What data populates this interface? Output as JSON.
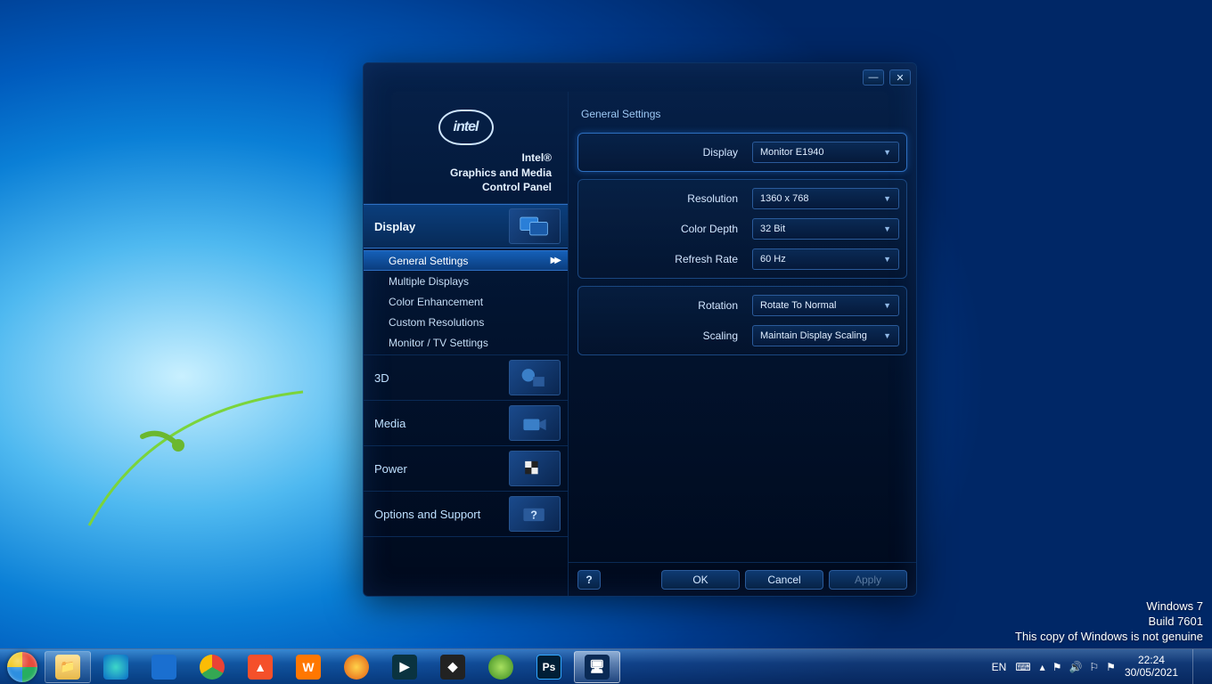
{
  "window": {
    "logo_text": "intel",
    "title_line1": "Intel®",
    "title_line2": "Graphics and Media",
    "title_line3": "Control Panel",
    "minimize_glyph": "—",
    "close_glyph": "✕"
  },
  "nav": {
    "display": "Display",
    "sub_general": "General Settings",
    "sub_multiple": "Multiple Displays",
    "sub_color": "Color Enhancement",
    "sub_custom": "Custom Resolutions",
    "sub_monitor": "Monitor / TV Settings",
    "three_d": "3D",
    "media": "Media",
    "power": "Power",
    "options": "Options and Support",
    "arrow": "▶▶"
  },
  "content": {
    "section_title": "General Settings",
    "rows": {
      "display_label": "Display",
      "display_value": "Monitor E1940",
      "resolution_label": "Resolution",
      "resolution_value": "1360 x 768",
      "depth_label": "Color Depth",
      "depth_value": "32 Bit",
      "refresh_label": "Refresh Rate",
      "refresh_value": "60 Hz",
      "rotation_label": "Rotation",
      "rotation_value": "Rotate To Normal",
      "scaling_label": "Scaling",
      "scaling_value": "Maintain Display Scaling"
    },
    "caret": "▼"
  },
  "buttons": {
    "help": "?",
    "ok": "OK",
    "cancel": "Cancel",
    "apply": "Apply"
  },
  "watermark": {
    "line1": "Windows 7",
    "line2": "Build 7601",
    "line3": "This copy of Windows is not genuine"
  },
  "tray": {
    "lang": "EN",
    "keyboard": "⌨",
    "up": "▴",
    "net": "⚑",
    "vol": "🔊",
    "action": "⚐",
    "flag": "⚑",
    "time": "22:24",
    "date": "30/05/2021"
  }
}
